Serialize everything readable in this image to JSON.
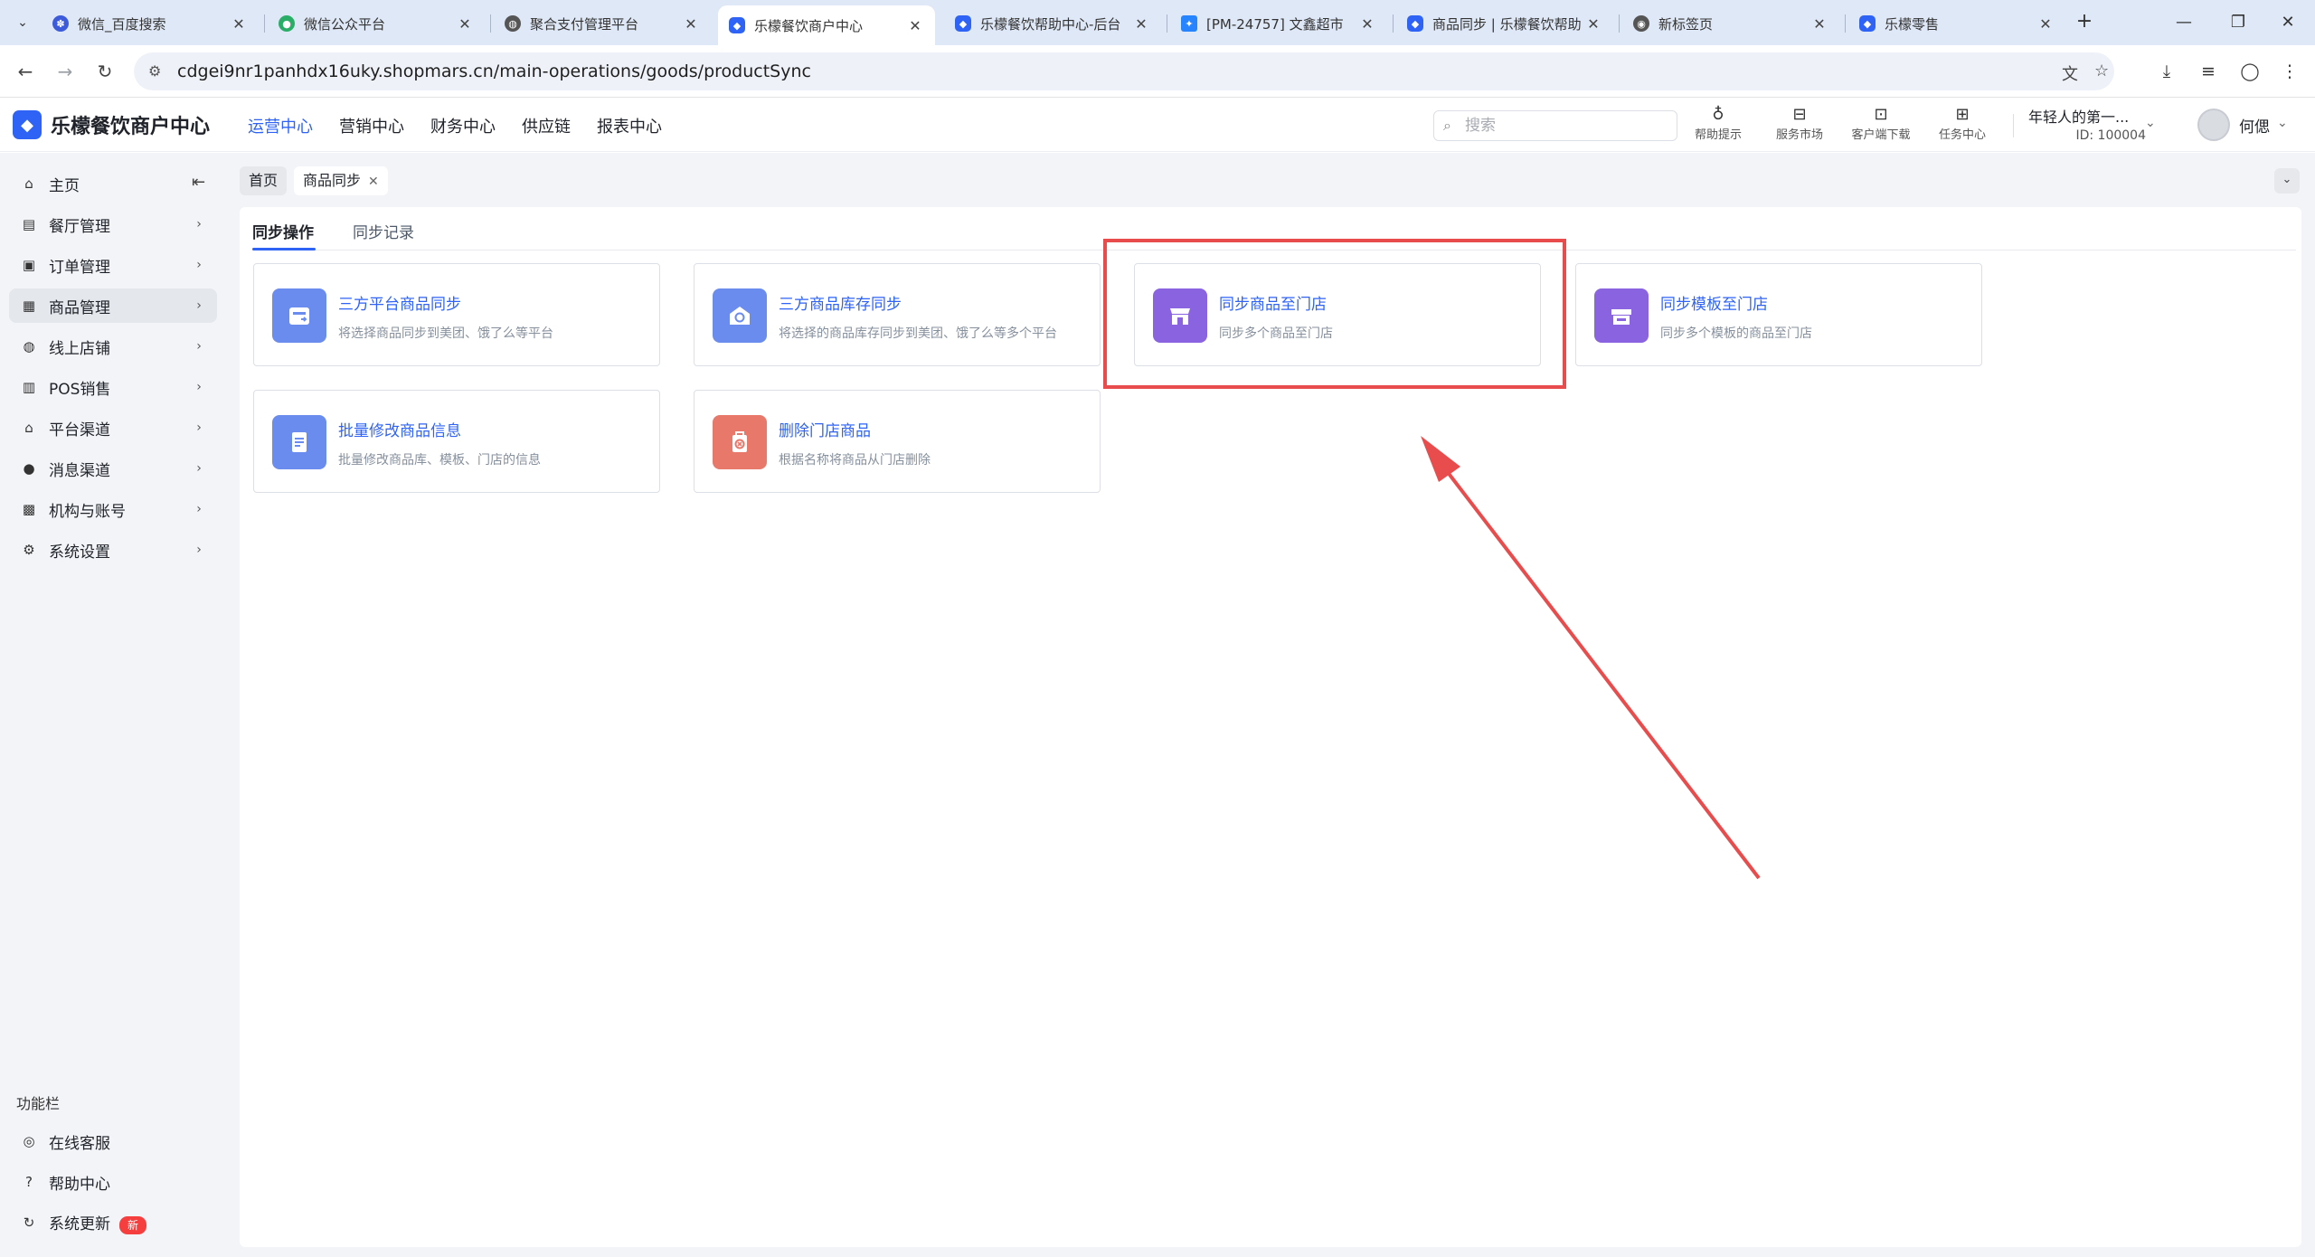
{
  "browser": {
    "tabs": [
      {
        "title": "微信_百度搜索",
        "favicon": "baidu-paw-icon",
        "color": "#3b5bdb",
        "active": false
      },
      {
        "title": "微信公众平台",
        "favicon": "wechat-icon",
        "color": "#2aae67",
        "active": false
      },
      {
        "title": "聚合支付管理平台",
        "favicon": "globe-icon",
        "color": "#555555",
        "active": false
      },
      {
        "title": "乐檬餐饮商户中心",
        "favicon": "lemon-logo-icon",
        "color": "#2e63f6",
        "active": true
      },
      {
        "title": "乐檬餐饮帮助中心-后台",
        "favicon": "lemon-logo-icon",
        "color": "#2e63f6",
        "active": false
      },
      {
        "title": "[PM-24757] 文鑫超市",
        "favicon": "jira-icon",
        "color": "#2684ff",
        "active": false
      },
      {
        "title": "商品同步 | 乐檬餐饮帮助",
        "favicon": "lemon-logo-icon",
        "color": "#2e63f6",
        "active": false
      },
      {
        "title": "新标签页",
        "favicon": "chrome-icon",
        "color": "#555555",
        "active": false
      },
      {
        "title": "乐檬零售",
        "favicon": "lemon-logo-icon",
        "color": "#2e63f6",
        "active": false
      }
    ],
    "url": "cdgei9nr1panhdx16uky.shopmars.cn/main-operations/goods/productSync"
  },
  "header": {
    "app_name": "乐檬餐饮商户中心",
    "nav": [
      "运营中心",
      "营销中心",
      "财务中心",
      "供应链",
      "报表中心"
    ],
    "active_nav": "运营中心",
    "search_placeholder": "搜索",
    "tools": [
      {
        "label": "帮助提示",
        "icon": "lightbulb-icon"
      },
      {
        "label": "服务市场",
        "icon": "shop-bag-icon"
      },
      {
        "label": "客户端下载",
        "icon": "folder-download-icon"
      },
      {
        "label": "任务中心",
        "icon": "clipboard-icon"
      }
    ],
    "org_name": "年轻人的第一...",
    "org_id": "ID: 100004",
    "user_name": "何偲"
  },
  "sidebar": {
    "items": [
      {
        "label": "主页",
        "icon": "home-icon",
        "has_children": false
      },
      {
        "label": "餐厅管理",
        "icon": "store-icon",
        "has_children": true
      },
      {
        "label": "订单管理",
        "icon": "order-icon",
        "has_children": true
      },
      {
        "label": "商品管理",
        "icon": "goods-icon",
        "has_children": true,
        "active": true
      },
      {
        "label": "线上店铺",
        "icon": "online-store-icon",
        "has_children": true
      },
      {
        "label": "POS销售",
        "icon": "pos-icon",
        "has_children": true
      },
      {
        "label": "平台渠道",
        "icon": "platform-icon",
        "has_children": true
      },
      {
        "label": "消息渠道",
        "icon": "message-icon",
        "has_children": true
      },
      {
        "label": "机构与账号",
        "icon": "account-icon",
        "has_children": true
      },
      {
        "label": "系统设置",
        "icon": "settings-gear-icon",
        "has_children": true
      }
    ],
    "function_title": "功能栏",
    "function_items": [
      {
        "label": "在线客服",
        "icon": "headset-icon"
      },
      {
        "label": "帮助中心",
        "icon": "question-icon"
      },
      {
        "label": "系统更新",
        "icon": "refresh-icon",
        "badge": "新"
      }
    ]
  },
  "page_tabs": [
    {
      "label": "首页",
      "active": false,
      "closable": false
    },
    {
      "label": "商品同步",
      "active": true,
      "closable": true
    }
  ],
  "sub_tabs": [
    "同步操作",
    "同步记录"
  ],
  "active_sub_tab": "同步操作",
  "cards": [
    {
      "title": "三方平台商品同步",
      "desc": "将选择商品同步到美团、饿了么等平台",
      "icon": "platform-sync-icon",
      "color": "#6b8cef"
    },
    {
      "title": "三方商品库存同步",
      "desc": "将选择的商品库存同步到美团、饿了么等多个平台",
      "icon": "inventory-sync-icon",
      "color": "#6b8cef"
    },
    {
      "title": "同步商品至门店",
      "desc": "同步多个商品至门店",
      "icon": "store-sync-icon",
      "color": "#8a63e0"
    },
    {
      "title": "同步模板至门店",
      "desc": "同步多个模板的商品至门店",
      "icon": "template-store-icon",
      "color": "#8a63e0"
    },
    {
      "title": "批量修改商品信息",
      "desc": "批量修改商品库、模板、门店的信息",
      "icon": "batch-edit-icon",
      "color": "#6b8cef"
    },
    {
      "title": "删除门店商品",
      "desc": "根据名称将商品从门店删除",
      "icon": "delete-goods-icon",
      "color": "#e8786a"
    }
  ],
  "annotation": {
    "color": "#e84c4c"
  }
}
